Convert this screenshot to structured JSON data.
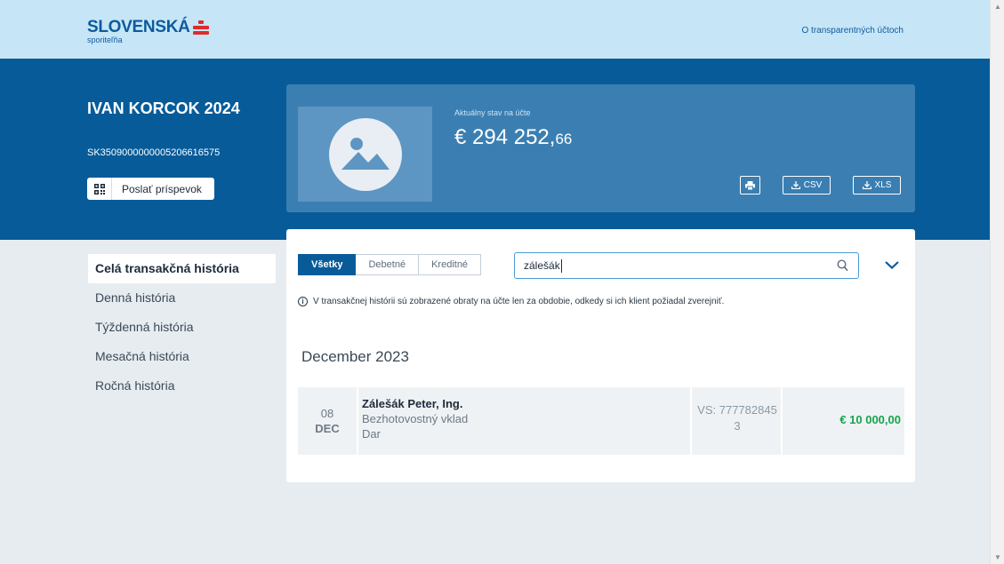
{
  "header": {
    "logo_main": "SLOVENSKÁ",
    "logo_sub": "sporiteľňa",
    "link": "O transparentných účtoch"
  },
  "account": {
    "name": "IVAN KORCOK 2024",
    "iban": "SK3509000000005206616575",
    "donate_label": "Poslať príspevok"
  },
  "balance": {
    "label": "Aktuálny stav na účte",
    "main": "€ 294 252,",
    "decimals": "66",
    "csv_label": "CSV",
    "xls_label": "XLS"
  },
  "menu": [
    {
      "label": "Celá transakčná história",
      "active": true
    },
    {
      "label": "Denná história",
      "active": false
    },
    {
      "label": "Týždenná história",
      "active": false
    },
    {
      "label": "Mesačná história",
      "active": false
    },
    {
      "label": "Ročná história",
      "active": false
    }
  ],
  "filters": {
    "tabs": [
      "Všetky",
      "Debetné",
      "Kreditné"
    ],
    "active_tab": "Všetky",
    "search_value": "zálešák"
  },
  "info_text": "V transakčnej histórii sú zobrazené obraty na účte len za obdobie, odkedy si ich klient požiadal zverejniť.",
  "groups": [
    {
      "month": "December 2023",
      "transactions": [
        {
          "day": "08",
          "mon": "DEC",
          "name": "Zálešák Peter, Ing.",
          "type": "Bezhotovostný vklad",
          "note": "Dar",
          "vs_line1": "VS: 777782845",
          "vs_line2": "3",
          "amount": "€ 10 000,00"
        }
      ]
    }
  ],
  "colors": {
    "header_bg": "#c6e6f7",
    "hero_bg": "#075b99",
    "card_bg": "#3b7fb2",
    "credit": "#14a44d"
  }
}
